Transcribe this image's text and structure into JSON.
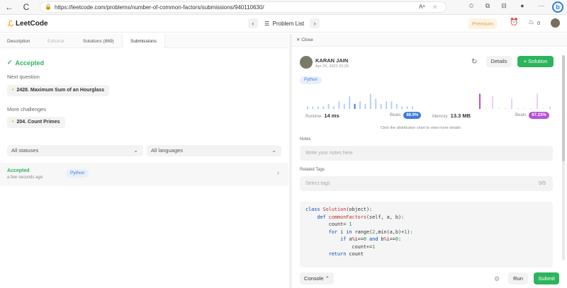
{
  "browser": {
    "url": "https://leetcode.com/problems/number-of-common-factors/submissions/940110630/",
    "back_icon": "←",
    "refresh_icon": "C"
  },
  "topbar": {
    "logo": "LeetCode",
    "problem_list": "Problem List",
    "premium": "Premium",
    "streak_count": "0"
  },
  "tabs": [
    "Description",
    "Editorial",
    "Solutions (869)",
    "Submissions"
  ],
  "left": {
    "status": "Accepted",
    "next_question_label": "Next question",
    "next_question": "2428. Maximum Sum of an Hourglass",
    "more_challenges_label": "More challenges",
    "more_challenge": "204. Count Primes",
    "filter_status": "All statuses",
    "filter_language": "All languages",
    "submission": {
      "status": "Accepted",
      "time": "a few seconds ago",
      "language": "Python"
    }
  },
  "right": {
    "close": "Close",
    "user": "KARAN JAIN",
    "date": "Apr 26, 2023 20:26",
    "details": "Details",
    "solution": "Solution",
    "language": "Python",
    "runtime_label": "Runtime",
    "runtime_value": "14 ms",
    "runtime_beats_label": "Beats",
    "runtime_beats": "88.9%",
    "memory_label": "Memory",
    "memory_value": "13.3 MB",
    "memory_beats_label": "Beats",
    "memory_beats": "67.23%",
    "chart_hint": "Click the distribution chart to view more details",
    "notes_label": "Notes",
    "notes_placeholder": "Write your notes here",
    "tags_label": "Related Tags",
    "tags_placeholder": "Select tags",
    "tags_count": "0/5",
    "console": "Console",
    "run": "Run",
    "submit": "Submit",
    "colors": {
      "accent": "#2db55d",
      "runtime_pill": "#3c7be0",
      "memory_pill": "#b84fd6",
      "brand": "#ffa116"
    }
  },
  "code": [
    "class Solution(object):",
    "    def commonFactors(self, a, b):",
    "        count= 1",
    "        for i in range(2,min(a,b)+1):",
    "            if a%i==0 and b%i==0:",
    "                count+=1",
    "        return count"
  ],
  "runtime_histogram": [
    1,
    1,
    1,
    1,
    2,
    1,
    3,
    2,
    5,
    2,
    3,
    2,
    6,
    4,
    2,
    3,
    3,
    2,
    1,
    1,
    1
  ],
  "memory_histogram": [
    6,
    0,
    5,
    0,
    0,
    4,
    0,
    0,
    0,
    6,
    0,
    1
  ]
}
